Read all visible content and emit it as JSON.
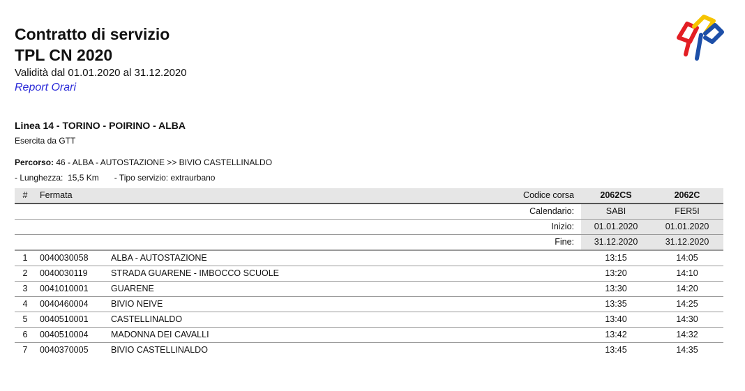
{
  "header": {
    "title_line1": "Contratto di servizio",
    "title_line2": "TPL CN 2020",
    "validity": "Validità dal 01.01.2020 al  31.12.2020",
    "report_link": "Report Orari"
  },
  "line": {
    "title": "Linea 14 - TORINO - POIRINO - ALBA",
    "operator": "Esercita da GTT",
    "route_label": "Percorso:",
    "route_value": " 46 - ALBA - AUTOSTAZIONE >> BIVIO CASTELLINALDO",
    "length": "- Lunghezza:  15,5 Km",
    "service_type": "- Tipo servizio: extraurbano"
  },
  "table": {
    "col_num": "#",
    "col_stop": "Fermata",
    "col_trip_code": "Codice corsa",
    "trips": [
      "2062CS",
      "2062C"
    ],
    "label_calendar": "Calendario:",
    "label_start": "Inizio:",
    "label_end": "Fine:",
    "calendars": [
      "SABI",
      "FER5I"
    ],
    "starts": [
      "01.01.2020",
      "01.01.2020"
    ],
    "ends": [
      "31.12.2020",
      "31.12.2020"
    ],
    "stops": [
      {
        "n": "1",
        "code": "0040030058",
        "name": "ALBA - AUTOSTAZIONE",
        "times": [
          "13:15",
          "14:05"
        ]
      },
      {
        "n": "2",
        "code": "0040030119",
        "name": "STRADA GUARENE - IMBOCCO SCUOLE",
        "times": [
          "13:20",
          "14:10"
        ]
      },
      {
        "n": "3",
        "code": "0041010001",
        "name": "GUARENE",
        "times": [
          "13:30",
          "14:20"
        ]
      },
      {
        "n": "4",
        "code": "0040460004",
        "name": "BIVIO NEIVE",
        "times": [
          "13:35",
          "14:25"
        ]
      },
      {
        "n": "5",
        "code": "0040510001",
        "name": "CASTELLINALDO",
        "times": [
          "13:40",
          "14:30"
        ]
      },
      {
        "n": "6",
        "code": "0040510004",
        "name": "MADONNA DEI CAVALLI",
        "times": [
          "13:42",
          "14:32"
        ]
      },
      {
        "n": "7",
        "code": "0040370005",
        "name": "BIVIO CASTELLINALDO",
        "times": [
          "13:45",
          "14:35"
        ]
      }
    ]
  },
  "logo": {
    "icon": "regional-transport-logo",
    "colors": [
      "#e31e24",
      "#f6c400",
      "#1d4fa8"
    ]
  }
}
